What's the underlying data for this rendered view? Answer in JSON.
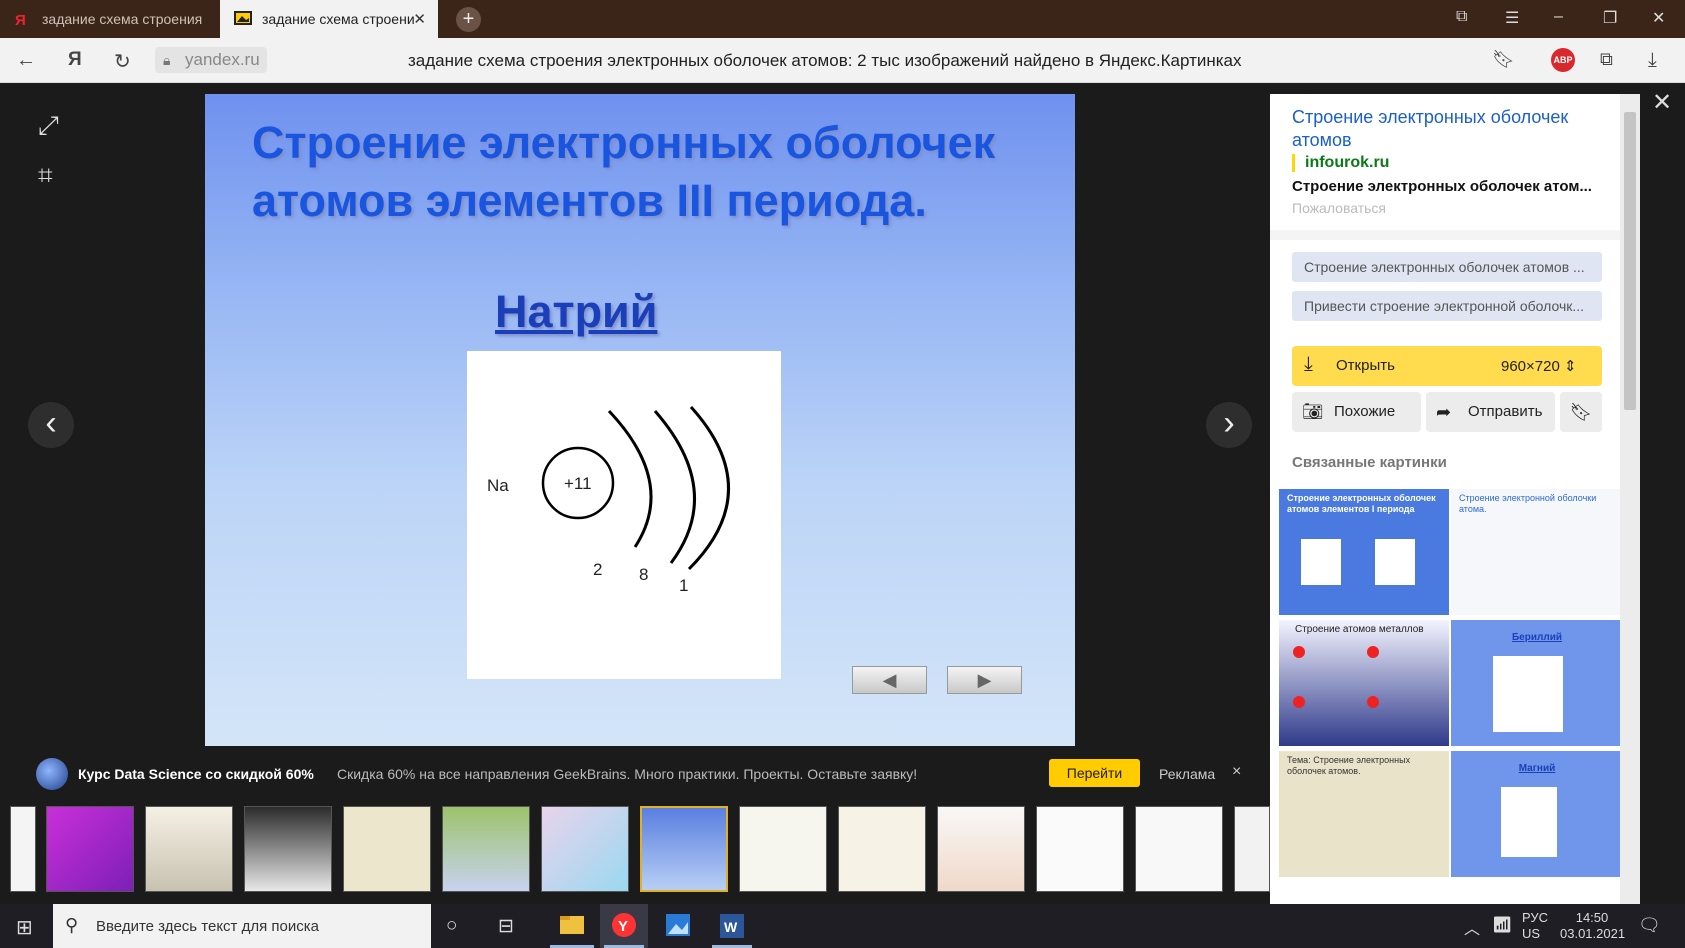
{
  "tabs": [
    {
      "title": "задание схема строения э"
    },
    {
      "title": "задание схема строени"
    }
  ],
  "address": {
    "domain": "yandex.ru",
    "page_title": "задание схема строения электронных оболочек атомов: 2 тыс изображений найдено в Яндекс.Картинках"
  },
  "slide": {
    "title": "Строение электронных оболочек атомов элементов III периода.",
    "subtitle": "Натрий",
    "element": "Na",
    "nucleus": "+11",
    "shells": [
      "2",
      "8",
      "1"
    ],
    "prev": "◀",
    "next": "▶"
  },
  "ad": {
    "title": "Курс Data Science со скидкой 60%",
    "text": "Скидка 60% на все направления GeekBrains. Много практики. Проекты. Оставьте заявку!",
    "go": "Перейти",
    "label": "Реклама",
    "close": "×"
  },
  "panel": {
    "title": "Строение электронных оболочек атомов",
    "site": "infourok.ru",
    "description": "Строение электронных оболочек атом...",
    "report": "Пожаловаться",
    "pills": [
      "Строение электронных оболочек атомов ...",
      "Привести строение электронной оболочк..."
    ],
    "open": "Открыть",
    "size": "960×720",
    "similar": "Похожие",
    "send": "Отправить",
    "related_title": "Связанные картинки",
    "related": [
      {
        "title": "Строение электронных оболочек атомов элементов I периода",
        "color": "#4a7ae0"
      },
      {
        "title": "Строение электронной оболочки атома.",
        "color": "#7fb0f0"
      },
      {
        "title": "Строение атомов металлов",
        "color": "#2f3a8a"
      },
      {
        "title": "Бериллий",
        "color": "#6f96ea"
      },
      {
        "title": "Тема: Строение электронных оболочек атомов.",
        "color": "#e9e3c9"
      },
      {
        "title": "Магний",
        "color": "#6f96ea"
      }
    ]
  },
  "taskbar": {
    "search_placeholder": "Введите здесь текст для поиска",
    "lang1": "РУС",
    "lang2": "US",
    "time": "14:50",
    "date": "03.01.2021"
  }
}
